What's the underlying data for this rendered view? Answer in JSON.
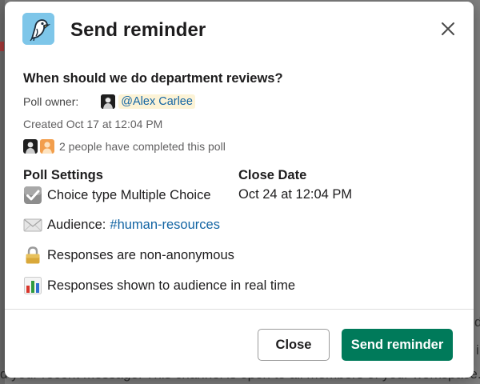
{
  "modal": {
    "title": "Send reminder",
    "question": "When should we do department reviews?",
    "owner_label": "Poll owner:",
    "owner_mention": "@Alex Carlee",
    "created": "Created Oct 17 at 12:04 PM",
    "completed": "2 people have completed this poll",
    "settings_heading": "Poll Settings",
    "close_date_heading": "Close Date",
    "choice_type": "Choice type Multiple Choice",
    "close_date_value": "Oct 24 at 12:04 PM",
    "audience_label": "Audience:",
    "audience_channel": "#human-resources",
    "responses_anonymity": "Responses are non-anonymous",
    "responses_visibility": "Responses shown to audience in real time",
    "close_button": "Close",
    "send_button": "Send reminder"
  },
  "background": {
    "bottom_text": "d your recent message. This channel is open to all members of your workspace.",
    "right_fragment_1": "d",
    "right_fragment_2": "i"
  },
  "colors": {
    "primary_button": "#007a5a",
    "link": "#1264a3",
    "mention_highlight": "#fcf3d6",
    "app_icon_bg": "#7ec6e9"
  },
  "icons": {
    "app": "bird-logo-icon",
    "close": "close-icon",
    "choice": "checkbox-check-icon",
    "audience": "envelope-icon",
    "anonymity": "padlock-icon",
    "visibility": "bar-chart-icon"
  }
}
